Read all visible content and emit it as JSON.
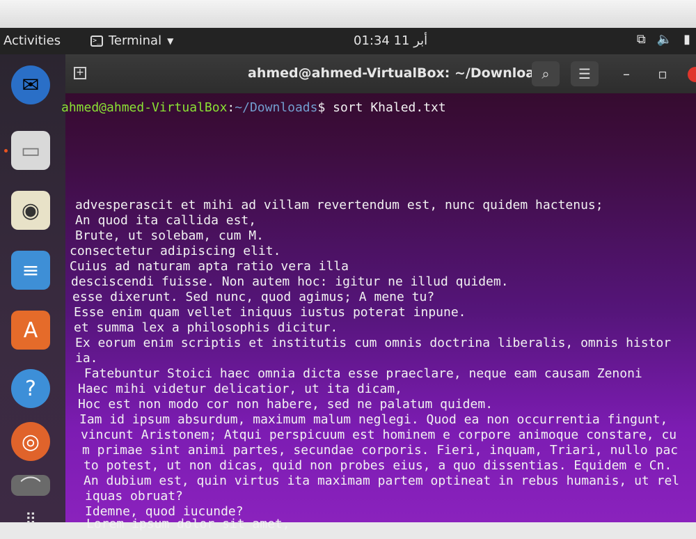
{
  "topbar": {
    "activities": "Activities",
    "app_name": "Terminal",
    "clock": "01:34 أبر 11"
  },
  "dock": {
    "items": [
      "thunderbird-icon",
      "files-icon",
      "rhythmbox-icon",
      "writer-icon",
      "software-icon",
      "help-icon",
      "ubuntu-icon",
      "drive-icon",
      "apps-grid-icon"
    ]
  },
  "window": {
    "title": "ahmed@ahmed-VirtualBox: ~/Downloads"
  },
  "prompt": {
    "user": "ahmed@ahmed-VirtualBox",
    "path": "~/Downloads",
    "command": "$ sort Khaled.txt"
  },
  "output_lines": [
    "advesperascit et mihi ad villam revertendum est, nunc quidem hactenus;",
    "An quod ita callida est,",
    "Brute, ut solebam, cum M.",
    "consectetur adipiscing elit.",
    "Cuius ad naturam apta ratio vera illa",
    "desciscendi fuisse. Non autem hoc: igitur ne illud quidem.",
    "esse dixerunt. Sed nunc, quod agimus; A mene tu?",
    "Esse enim quam vellet iniquus iustus poterat inpune.",
    "et summa lex a philosophis dicitur.",
    "Ex eorum enim scriptis et institutis cum omnis doctrina liberalis, omnis histor",
    "ia.",
    " Fatebuntur Stoici haec omnia dicta esse praeclare, neque eam causam Zenoni",
    "Haec mihi videtur delicatior, ut ita dicam,",
    "Hoc est non modo cor non habere, sed ne palatum quidem.",
    "Iam id ipsum absurdum, maximum malum neglegi. Quod ea non occurrentia fingunt,",
    "vincunt Aristonem; Atqui perspicuum est hominem e corpore animoque constare, cu",
    "m primae sint animi partes, secundae corporis. Fieri, inquam, Triari, nullo pac",
    "to potest, ut non dicas, quid non probes eius, a quo dissentias. Equidem e Cn.",
    "An dubium est, quin virtus ita maximam partem optineat in rebus humanis, ut rel",
    "iquas obruat?",
    "Idemne, quod iucunde?",
    "Lorem ipsum dolor sit amet,"
  ]
}
